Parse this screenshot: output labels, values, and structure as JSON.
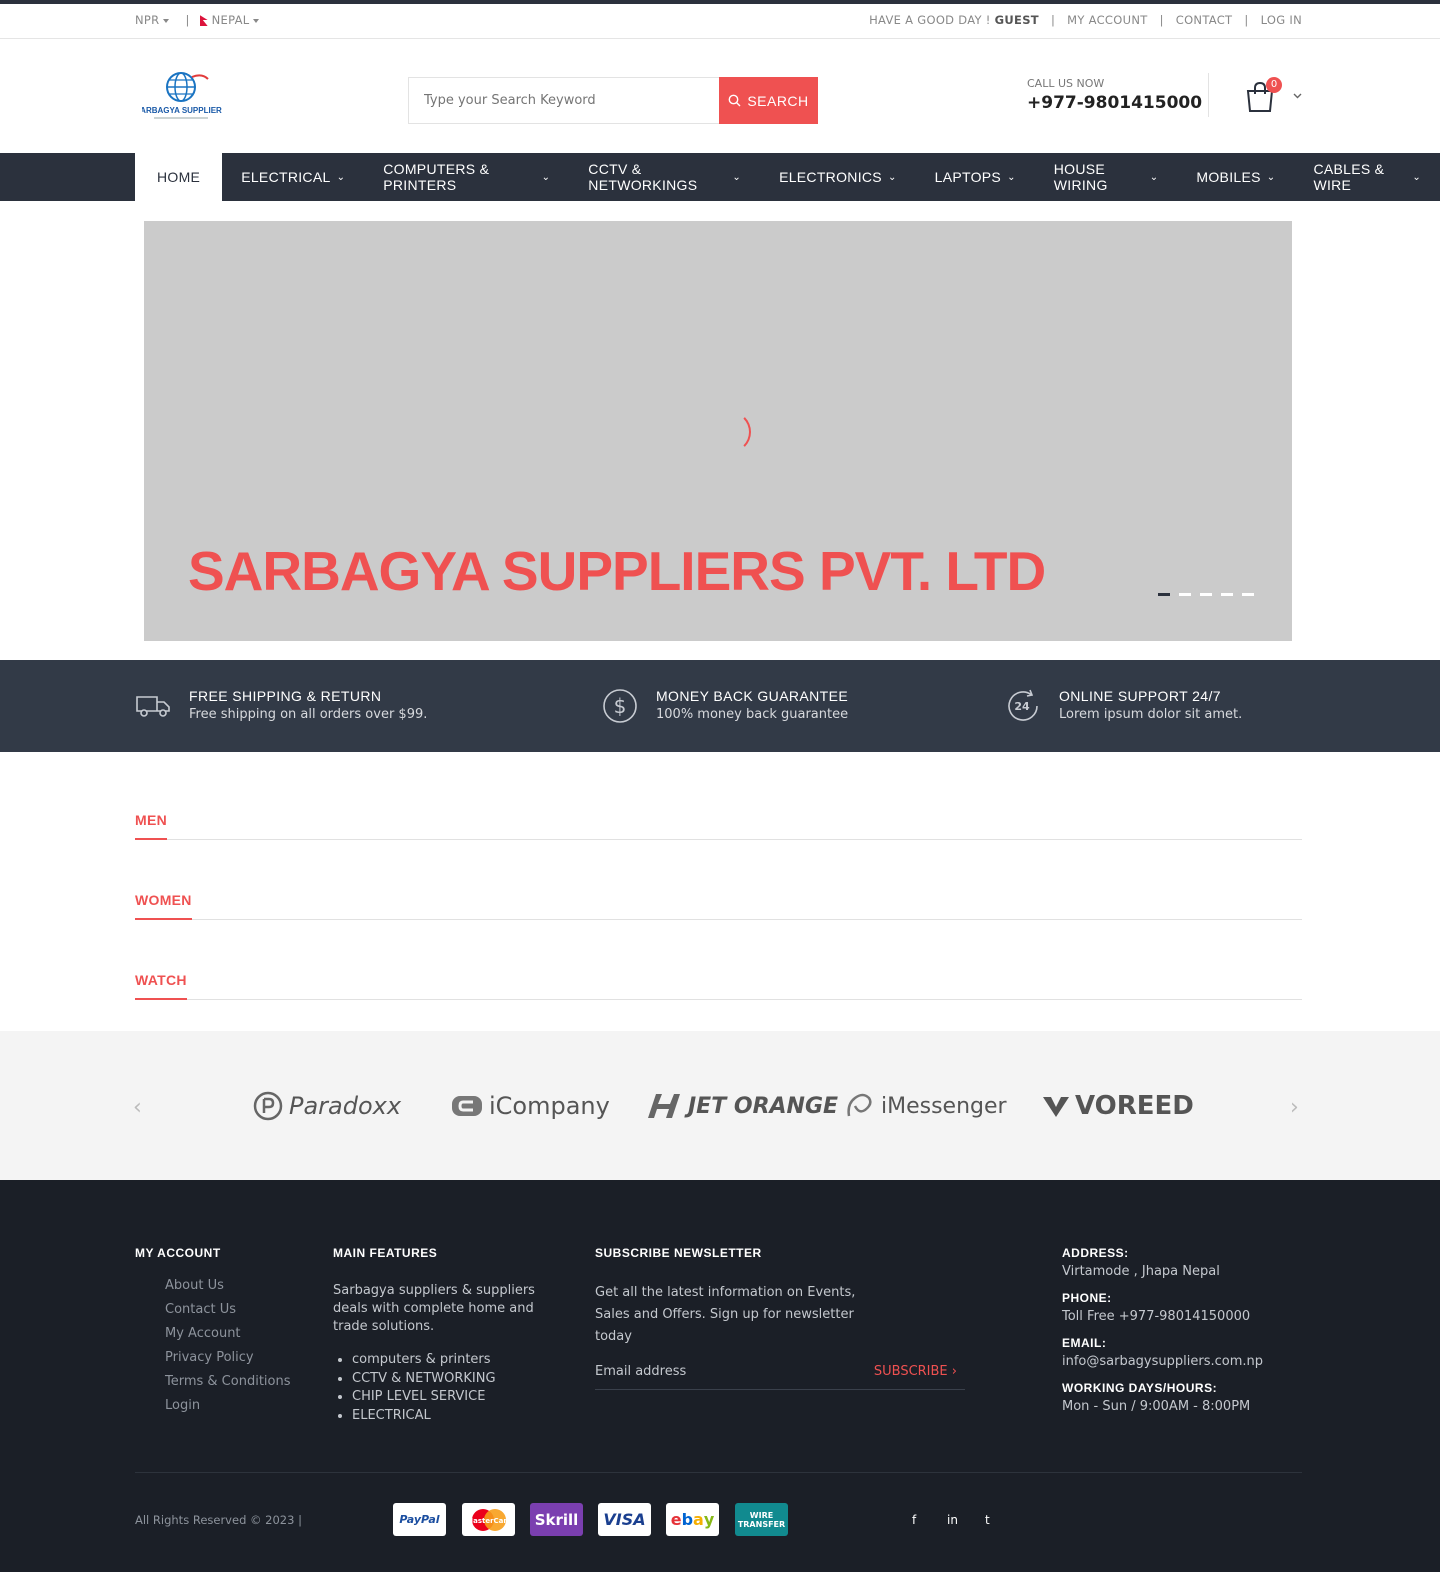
{
  "topbar": {
    "currency": "NPR",
    "separator": "|",
    "country": "NEPAL",
    "greeting": "HAVE A GOOD DAY !",
    "user": "GUEST",
    "links": [
      "MY ACCOUNT",
      "CONTACT",
      "LOG IN"
    ]
  },
  "header": {
    "logo_text": "SARBAGYA SUPPLIERS",
    "search_placeholder": "Type your Search Keyword",
    "search_button": "SEARCH",
    "call_label": "CALL US NOW",
    "phone": "+977-9801415000",
    "cart_count": "0"
  },
  "nav": {
    "items": [
      "HOME",
      "ELECTRICAL",
      "COMPUTERS & PRINTERS",
      "CCTV & NETWORKINGS",
      "ELECTRONICS",
      "LAPTOPS",
      "HOUSE WIRING",
      "MOBILES",
      "CABLES & WIRE"
    ]
  },
  "slider": {
    "title": "SARBAGYA SUPPLIERS PVT. LTD",
    "slides": 5,
    "active_slide": 1
  },
  "features": [
    {
      "title": "FREE SHIPPING & RETURN",
      "text": "Free shipping on all orders over $99.",
      "icon": "truck-icon"
    },
    {
      "title": "MONEY BACK GUARANTEE",
      "text": "100% money back guarantee",
      "icon": "dollar-icon"
    },
    {
      "title": "ONLINE SUPPORT 24/7",
      "text": "Lorem ipsum dolor sit amet.",
      "icon": "support-24-icon"
    }
  ],
  "sections": [
    "MEN",
    "WOMEN",
    "WATCH"
  ],
  "brands": [
    "Paradoxx",
    "iCompany",
    "JET ORANGE",
    "iMessenger",
    "VOREED"
  ],
  "footer": {
    "account_title": "MY ACCOUNT",
    "account_links": [
      "About Us",
      "Contact Us",
      "My Account",
      "Privacy Policy",
      "Terms & Conditions",
      "Login"
    ],
    "features_title": "MAIN FEATURES",
    "features_text": "Sarbagya suppliers & suppliers deals with complete home and trade solutions.",
    "features_list": [
      "computers & printers",
      "CCTV & NETWORKING",
      "CHIP LEVEL SERVICE",
      "ELECTRICAL"
    ],
    "newsletter_title": "SUBSCRIBE NEWSLETTER",
    "newsletter_text": "Get all the latest information on Events, Sales and Offers. Sign up for newsletter today",
    "newsletter_placeholder": "Email address",
    "subscribe": "SUBSCRIBE",
    "address_label": "ADDRESS:",
    "address": "Virtamode , Jhapa Nepal",
    "phone_label": "PHONE:",
    "phone": "Toll Free +977-98014150000",
    "email_label": "EMAIL:",
    "email": "info@sarbagysuppliers.com.np",
    "hours_label": "WORKING DAYS/HOURS:",
    "hours": "Mon - Sun / 9:00AM - 8:00PM",
    "copyright": "All Rights Reserved © 2023 |",
    "payments": [
      "PayPal",
      "MasterCard",
      "Skrill",
      "VISA",
      "ebay",
      "WIRE TRANSFER"
    ],
    "social": [
      "f",
      "in",
      "t"
    ]
  },
  "colors": {
    "accent": "#ef5151",
    "dark": "#2b313d",
    "footer": "#1b1f27"
  }
}
